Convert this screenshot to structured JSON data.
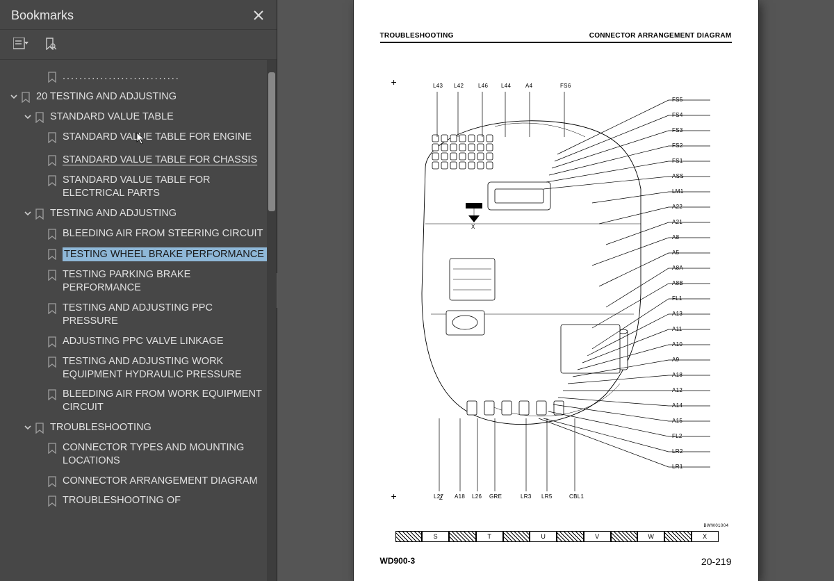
{
  "sidebar": {
    "title": "Bookmarks",
    "truncated_top": "............................",
    "nodes": [
      {
        "lv": 0,
        "expand": "open",
        "label": "20 TESTING AND ADJUSTING"
      },
      {
        "lv": 1,
        "expand": "open",
        "label": "STANDARD VALUE TABLE"
      },
      {
        "lv": 2,
        "label": "STANDARD VALUE TABLE FOR ENGINE",
        "cursor": true
      },
      {
        "lv": 2,
        "label": "STANDARD VALUE TABLE FOR CHASSIS",
        "underlined": true
      },
      {
        "lv": 2,
        "label": "STANDARD VALUE TABLE FOR ELECTRICAL PARTS"
      },
      {
        "lv": 1,
        "expand": "open",
        "label": "TESTING AND ADJUSTING"
      },
      {
        "lv": 2,
        "label": "BLEEDING AIR FROM STEERING CIRCUIT"
      },
      {
        "lv": 2,
        "label": "TESTING WHEEL BRAKE PERFORMANCE",
        "hilite": true
      },
      {
        "lv": 2,
        "label": "TESTING PARKING BRAKE PERFORMANCE"
      },
      {
        "lv": 2,
        "label": "TESTING AND ADJUSTING PPC PRESSURE"
      },
      {
        "lv": 2,
        "label": "ADJUSTING PPC VALVE LINKAGE"
      },
      {
        "lv": 2,
        "label": "TESTING AND ADJUSTING WORK EQUIPMENT HYDRAULIC PRESSURE"
      },
      {
        "lv": 2,
        "label": "BLEEDING AIR FROM WORK EQUIPMENT CIRCUIT"
      },
      {
        "lv": 1,
        "expand": "open",
        "label": "TROUBLESHOOTING"
      },
      {
        "lv": 2,
        "label": "CONNECTOR TYPES AND MOUNTING LOCATIONS"
      },
      {
        "lv": 2,
        "label": "CONNECTOR ARRANGEMENT DIAGRAM"
      },
      {
        "lv": 2,
        "label": "TROUBLESHOOTING OF",
        "cutoff": true
      }
    ]
  },
  "page": {
    "hdr_left": "TROUBLESHOOTING",
    "hdr_right": "CONNECTOR ARRANGEMENT DIAGRAM",
    "model": "WD900-3",
    "pageno": "20-219",
    "figcode": "BWW01004",
    "top_labels": [
      "L43",
      "L42",
      "L46",
      "L44",
      "A4",
      "FS6"
    ],
    "right_labels": [
      "FS5",
      "FS4",
      "FS3",
      "FS2",
      "FS1",
      "ASS",
      "LM1",
      "A22",
      "A21",
      "A8",
      "A5",
      "A8A",
      "A8B",
      "FL1",
      "A13",
      "A11",
      "A10",
      "A9",
      "A18",
      "A12",
      "A14",
      "A15",
      "FL2",
      "LR2",
      "LR1"
    ],
    "bottom_labels": [
      "L27",
      "A18",
      "L26",
      "GRE",
      "LR3",
      "LR5",
      "CBL1"
    ],
    "mid_labels": {
      "x": "X",
      "z": "Z"
    },
    "ruler": [
      "S",
      "T",
      "U",
      "V",
      "W",
      "X"
    ]
  }
}
